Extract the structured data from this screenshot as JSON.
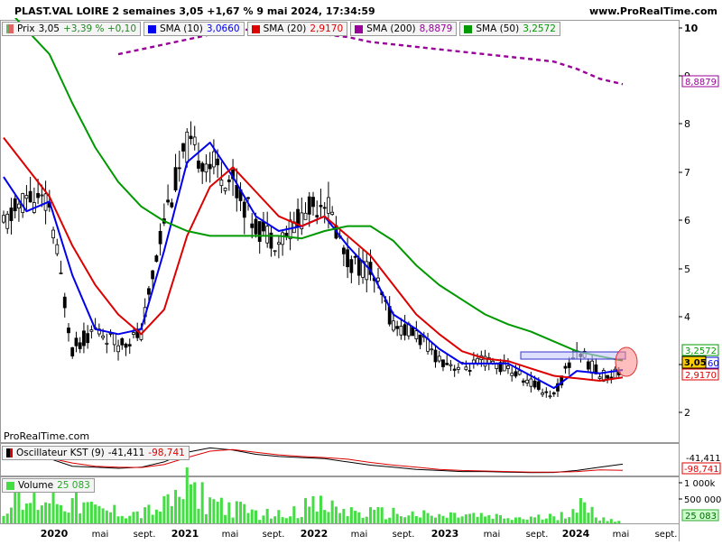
{
  "header": {
    "title": "PLAST.VAL LOIRE 2 semaines 3,05 +1,67 % 9 mai 2024, 17:34:59",
    "site": "www.ProRealTime.com",
    "watermark": "ProRealTime.com"
  },
  "legend_price": [
    {
      "label": "Prix",
      "value": "3,05",
      "extra": "+3,39 % +0,10",
      "color": "#e06666",
      "swatch": "price-icon"
    },
    {
      "label": "SMA (10)",
      "value": "3,0660",
      "color": "#0000ee"
    },
    {
      "label": "SMA (20)",
      "value": "2,9170",
      "color": "#dd0000"
    },
    {
      "label": "SMA (200)",
      "value": "8,8879",
      "color": "#990099"
    },
    {
      "label": "SMA (50)",
      "value": "3,2572",
      "color": "#009900"
    }
  ],
  "legend_kst": {
    "label": "Oscillateur KST (9)",
    "value1": "-41,411",
    "value2": "-98,741"
  },
  "legend_volume": {
    "label": "Volume",
    "value": "25 083"
  },
  "price_axis": {
    "ticks": [
      "10",
      "9",
      "8",
      "7",
      "6",
      "5",
      "4",
      "3",
      "2"
    ]
  },
  "price_badges": {
    "sma200": "8,8879",
    "sma50": "3,2572",
    "price": "3,05",
    "sma10_part": "60",
    "sma20": "2,9170"
  },
  "kst_axis": {
    "value1": "-41,411",
    "value2": "-98,741"
  },
  "volume_axis": {
    "ticks": [
      "1 000k",
      "500 000"
    ],
    "current": "25 083"
  },
  "time_axis": [
    "2020",
    "mai",
    "sept.",
    "2021",
    "mai",
    "sept.",
    "2022",
    "mai",
    "sept.",
    "2023",
    "mai",
    "sept.",
    "2024",
    "mai",
    "sept."
  ],
  "colors": {
    "sma10": "#0000ee",
    "sma20": "#dd0000",
    "sma50": "#009900",
    "sma200": "#990099",
    "candle": "#000000",
    "volume": "#44dd44",
    "kst_fast": "#000000",
    "kst_slow": "#dd0000",
    "highlight": "#ff6666",
    "box": "#3333cc"
  },
  "chart_data": {
    "type": "line",
    "title": "PLAST.VAL LOIRE 2 semaines 3,05 +1,67 % 9 mai 2024, 17:34:59",
    "xlabel": "",
    "ylabel": "",
    "x": [
      "2019-11",
      "2020-01",
      "2020-03",
      "2020-05",
      "2020-07",
      "2020-09",
      "2020-11",
      "2021-01",
      "2021-03",
      "2021-05",
      "2021-07",
      "2021-09",
      "2021-11",
      "2022-01",
      "2022-03",
      "2022-05",
      "2022-07",
      "2022-09",
      "2022-11",
      "2023-01",
      "2023-03",
      "2023-05",
      "2023-07",
      "2023-09",
      "2023-11",
      "2024-01",
      "2024-03",
      "2024-05"
    ],
    "ylim": [
      1.6,
      10.2
    ],
    "series": [
      {
        "name": "Prix",
        "values": [
          6.0,
          6.6,
          6.4,
          3.5,
          3.9,
          3.6,
          3.8,
          6.2,
          7.6,
          7.3,
          6.9,
          6.0,
          5.7,
          6.2,
          6.6,
          5.3,
          5.1,
          4.0,
          3.8,
          3.3,
          3.1,
          3.25,
          3.1,
          2.8,
          2.55,
          3.5,
          2.95,
          3.05
        ]
      },
      {
        "name": "SMA (10)",
        "values": [
          7.0,
          6.3,
          6.5,
          5.0,
          3.9,
          3.8,
          3.9,
          5.5,
          7.3,
          7.7,
          7.0,
          6.2,
          5.9,
          6.0,
          6.2,
          5.6,
          5.1,
          4.2,
          3.9,
          3.5,
          3.2,
          3.2,
          3.2,
          2.95,
          2.7,
          3.05,
          3.0,
          3.07
        ]
      },
      {
        "name": "SMA (20)",
        "values": [
          7.8,
          7.2,
          6.6,
          5.6,
          4.8,
          4.2,
          3.8,
          4.3,
          5.8,
          6.8,
          7.2,
          6.7,
          6.2,
          6.0,
          6.2,
          5.8,
          5.4,
          4.8,
          4.2,
          3.8,
          3.45,
          3.3,
          3.25,
          3.1,
          2.95,
          2.9,
          2.85,
          2.92
        ]
      },
      {
        "name": "SMA (50)",
        "values": [
          10.5,
          10.0,
          9.5,
          8.5,
          7.6,
          6.9,
          6.4,
          6.1,
          5.9,
          5.8,
          5.8,
          5.8,
          5.8,
          5.75,
          5.9,
          6.0,
          6.0,
          5.7,
          5.2,
          4.8,
          4.5,
          4.2,
          4.0,
          3.85,
          3.65,
          3.45,
          3.35,
          3.26
        ]
      },
      {
        "name": "SMA (200)",
        "values": [
          null,
          null,
          null,
          null,
          null,
          9.5,
          9.6,
          9.7,
          9.8,
          9.9,
          10.0,
          10.0,
          10.0,
          9.95,
          9.9,
          9.85,
          9.75,
          9.7,
          9.65,
          9.6,
          9.55,
          9.5,
          9.45,
          9.4,
          9.35,
          9.2,
          9.0,
          8.89
        ]
      }
    ],
    "kst": {
      "name": "Oscillateur KST (9)",
      "fast": [
        20,
        30,
        10,
        -60,
        -70,
        -80,
        -70,
        -20,
        70,
        110,
        90,
        50,
        30,
        20,
        10,
        -20,
        -50,
        -70,
        -90,
        -100,
        -110,
        -110,
        -115,
        -120,
        -118,
        -100,
        -70,
        -41.411
      ],
      "slow": [
        10,
        20,
        15,
        -30,
        -60,
        -70,
        -72,
        -45,
        20,
        80,
        95,
        70,
        45,
        30,
        20,
        5,
        -25,
        -50,
        -70,
        -90,
        -100,
        -105,
        -110,
        -115,
        -116,
        -110,
        -95,
        -98.741
      ]
    },
    "volume": {
      "name": "Volume",
      "ylim": [
        0,
        1200000
      ],
      "values": [
        650000,
        550000,
        800000,
        650000,
        400000,
        350000,
        300000,
        500000,
        1000000,
        700000,
        450000,
        300000,
        250000,
        500000,
        500000,
        350000,
        300000,
        300000,
        250000,
        200000,
        250000,
        200000,
        150000,
        150000,
        200000,
        550000,
        200000,
        25083
      ]
    },
    "legend": "top-left",
    "grid": false
  }
}
